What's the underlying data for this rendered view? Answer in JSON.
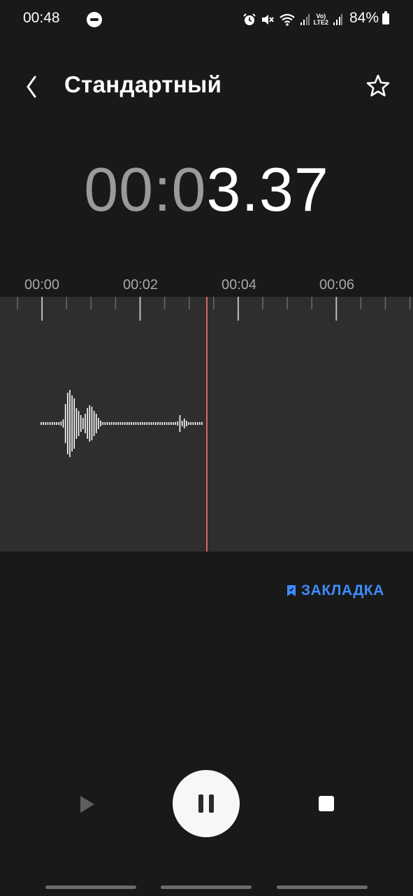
{
  "status_bar": {
    "time": "00:48",
    "battery": "84%",
    "network_label_top": "Vo)",
    "network_label_bottom": "LTE2",
    "icons": [
      "do-not-disturb-icon",
      "alarm-icon",
      "mute-icon",
      "wifi-icon",
      "signal-icon",
      "battery-icon"
    ]
  },
  "header": {
    "title": "Стандартный"
  },
  "timer": {
    "dim_part": "00:0",
    "bright_part": "3.37"
  },
  "timeline": {
    "labels": [
      "00:00",
      "00:02",
      "00:04",
      "00:06"
    ]
  },
  "bookmark": {
    "label": "ЗАКЛАДКА"
  },
  "colors": {
    "background": "#191919",
    "wave_area": "#2e2e2e",
    "playhead": "#e0645f",
    "accent": "#3e8bff"
  }
}
